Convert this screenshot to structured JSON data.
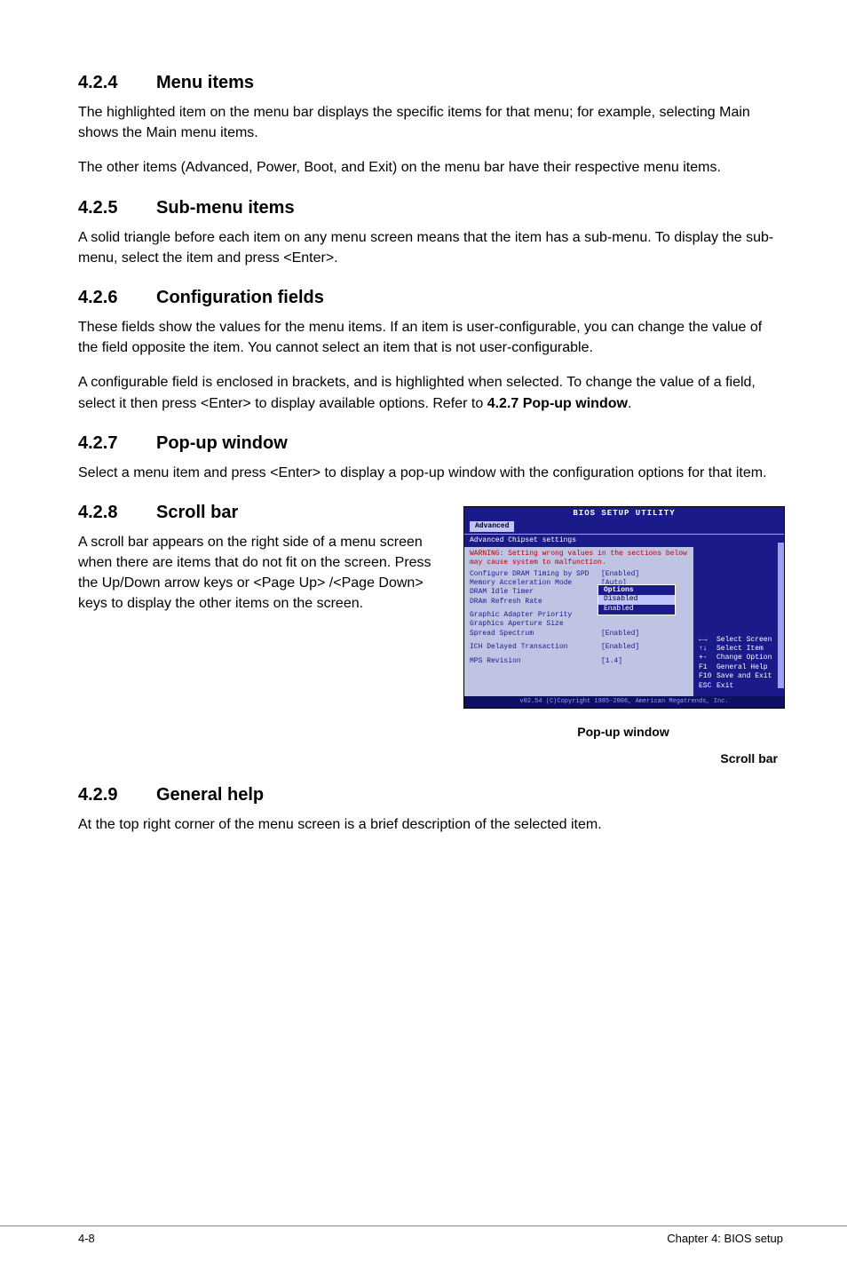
{
  "sections": {
    "s424": {
      "num": "4.2.4",
      "title": "Menu items",
      "p1": "The highlighted item on the menu bar displays the specific items for that menu; for example, selecting Main shows the Main menu items.",
      "p2": "The other items (Advanced, Power, Boot, and Exit) on the menu bar have their respective menu items."
    },
    "s425": {
      "num": "4.2.5",
      "title": "Sub-menu items",
      "p1": "A solid triangle before each item on any menu screen means that the item has a sub-menu. To display the sub-menu, select the item and press <Enter>."
    },
    "s426": {
      "num": "4.2.6",
      "title": "Configuration fields",
      "p1": "These fields show the values for the menu items. If an item is user-configurable, you can change the value of the field opposite the item. You cannot select an item that is not user-configurable.",
      "p2a": "A configurable field is enclosed in brackets, and is highlighted when selected. To change the value of a field, select it then press <Enter> to display available options. Refer to ",
      "p2b": "4.2.7 Pop-up window",
      "p2c": "."
    },
    "s427": {
      "num": "4.2.7",
      "title": "Pop-up window",
      "p1": "Select a menu item and press <Enter> to display a pop-up window with the configuration options for that item."
    },
    "s428": {
      "num": "4.2.8",
      "title": "Scroll bar",
      "p1": "A scroll bar appears on the right side of a menu screen when there are items that do not fit on the screen. Press the Up/Down arrow keys or <Page Up> /<Page Down> keys to display the other items on the screen."
    },
    "s429": {
      "num": "4.2.9",
      "title": "General help",
      "p1": "At the top right corner of the menu screen is a brief description of the selected item."
    }
  },
  "bios": {
    "title": "BIOS SETUP UTILITY",
    "tab": "Advanced",
    "header": "Advanced Chipset settings",
    "warning": "WARNING: Setting wrong values in the sections below may cause system to malfunction.",
    "items": [
      {
        "label": "Configure DRAM Timing by SPD",
        "value": "[Enabled]"
      },
      {
        "label": "Memory Acceleration Mode",
        "value": "[Auto]"
      },
      {
        "label": "DRAM Idle Timer",
        "value": ""
      },
      {
        "label": "DRAm Refresh Rate",
        "value": ""
      }
    ],
    "items2": [
      {
        "label": "Graphic Adapter Priority",
        "value": ""
      },
      {
        "label": "Graphics Aperture Size",
        "value": ""
      },
      {
        "label": "Spread Spectrum",
        "value": "[Enabled]"
      }
    ],
    "items3": [
      {
        "label": "ICH Delayed Transaction",
        "value": "[Enabled]"
      }
    ],
    "items4": [
      {
        "label": "MPS Revision",
        "value": "[1.4]"
      }
    ],
    "popup": {
      "title": "Options",
      "opts": [
        "Disabled",
        "Enabled"
      ]
    },
    "help": [
      {
        "key": "←→",
        "text": "Select Screen"
      },
      {
        "key": "↑↓",
        "text": "Select Item"
      },
      {
        "key": "+-",
        "text": "Change Option"
      },
      {
        "key": "F1",
        "text": "General Help"
      },
      {
        "key": "F10",
        "text": "Save and Exit"
      },
      {
        "key": "ESC",
        "text": "Exit"
      }
    ],
    "footer": "v02.54 (C)Copyright 1985-2006, American Megatrends, Inc.",
    "caption_popup": "Pop-up window",
    "caption_scroll": "Scroll bar"
  },
  "page_footer": {
    "left": "4-8",
    "right": "Chapter 4: BIOS setup"
  }
}
